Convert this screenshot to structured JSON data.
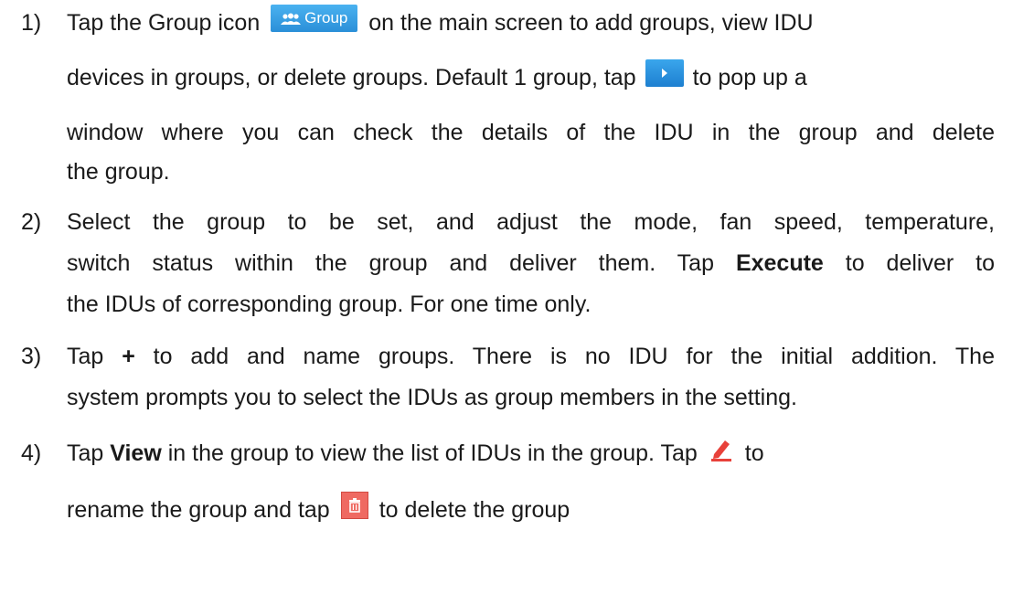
{
  "items": [
    {
      "number": "1)",
      "lines": {
        "l1a": "Tap the Group icon",
        "group_icon_label": "Group",
        "l1b": "on the main screen to add groups, view IDU",
        "l2a": "devices in groups, or delete groups. Default 1 group, tap",
        "l2b": "to pop up a",
        "l3": "window where you can check the details of the IDU in the group and delete",
        "l4": "the group."
      }
    },
    {
      "number": "2)",
      "lines": {
        "l1": "Select the group to be set, and adjust the mode, fan speed, temperature,",
        "l2a": "switch status within the group and deliver them. Tap",
        "l2b_bold": "Execute",
        "l2c": "to deliver to",
        "l3": "the IDUs of corresponding group. For one time only."
      }
    },
    {
      "number": "3)",
      "lines": {
        "l1a": "Tap",
        "l1b_bold": "+",
        "l1c": "to add and name groups. There is no IDU for the initial addition. The",
        "l2": "system prompts you to select the IDUs as group members in the setting."
      }
    },
    {
      "number": "4)",
      "lines": {
        "l1a": "Tap",
        "l1b_bold": "View",
        "l1c": "in the group to view the list of IDUs in the group. Tap",
        "l1d": "to",
        "l2a": "rename the group and tap",
        "l2b": "to delete the group"
      }
    }
  ],
  "icons": {
    "group": "group-people-icon",
    "play": "play-arrow-icon",
    "edit": "edit-pencil-icon",
    "delete": "trash-icon"
  },
  "colors": {
    "group_button": "#3aa3ec",
    "play_button": "#2a8fd8",
    "edit_icon": "#e8413a",
    "trash_icon": "#ef6a62"
  }
}
